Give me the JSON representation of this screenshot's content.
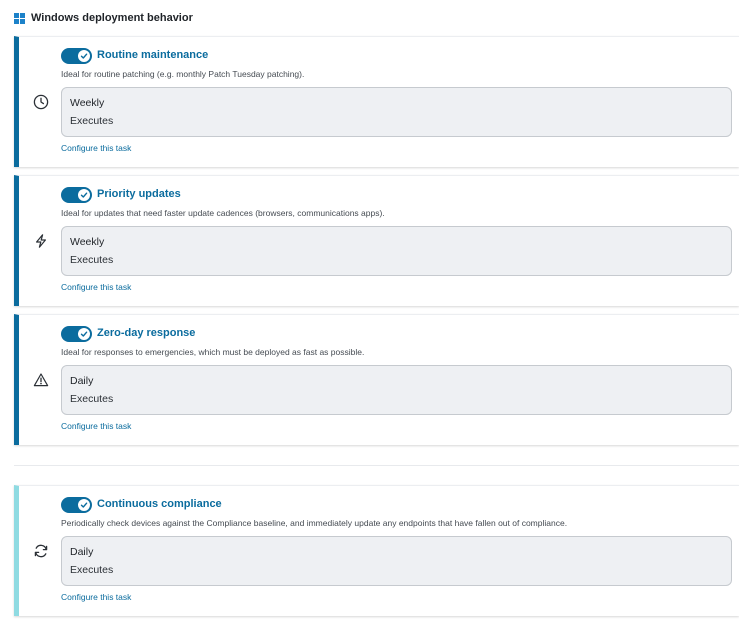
{
  "header": {
    "title": "Windows deployment behavior",
    "icon": "windows-logo-icon"
  },
  "colors": {
    "accent": "#0b6c9e",
    "accent_light": "#8fdbe2",
    "panel_bg": "#eef0f3"
  },
  "tasks": [
    {
      "title": "Routine maintenance",
      "enabled": true,
      "description": "Ideal for routine patching (e.g. monthly Patch Tuesday patching).",
      "icon": "clock-icon",
      "frequency": "Weekly",
      "status": "Executes",
      "link": "Configure this task"
    },
    {
      "title": "Priority updates",
      "enabled": true,
      "description": "Ideal for updates that need faster update cadences (browsers, communications apps).",
      "icon": "lightning-icon",
      "frequency": "Weekly",
      "status": "Executes",
      "link": "Configure this task"
    },
    {
      "title": "Zero-day response",
      "enabled": true,
      "description": "Ideal for responses to emergencies, which must be deployed as fast as possible.",
      "icon": "warning-icon",
      "frequency": "Daily",
      "status": "Executes",
      "link": "Configure this task"
    },
    {
      "title": "Continuous compliance",
      "enabled": true,
      "description": "Periodically check devices against the Compliance baseline, and immediately update any endpoints that have fallen out of compliance.",
      "icon": "refresh-icon",
      "frequency": "Daily",
      "status": "Executes",
      "link": "Configure this task"
    }
  ]
}
